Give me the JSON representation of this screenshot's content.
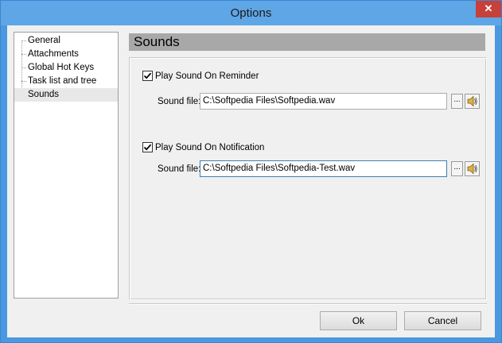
{
  "window": {
    "title": "Options",
    "close_glyph": "✕"
  },
  "tree": {
    "items": [
      {
        "label": "General"
      },
      {
        "label": "Attachments"
      },
      {
        "label": "Global Hot Keys"
      },
      {
        "label": "Task list and tree"
      },
      {
        "label": "Sounds",
        "selected": true
      }
    ]
  },
  "page": {
    "heading": "Sounds",
    "reminder": {
      "checkbox_label": "Play Sound On Reminder",
      "checked": true,
      "file_label": "Sound file:",
      "file_value": "C:\\Softpedia Files\\Softpedia.wav",
      "browse_label": "..."
    },
    "notification": {
      "checkbox_label": "Play Sound On Notification",
      "checked": true,
      "file_label": "Sound file:",
      "file_value": "C:\\Softpedia Files\\Softpedia-Test.wav",
      "browse_label": "..."
    }
  },
  "buttons": {
    "ok": "Ok",
    "cancel": "Cancel"
  },
  "icons": {
    "close": "close-icon",
    "check": "checkmark-icon",
    "speaker": "speaker-icon"
  },
  "colors": {
    "titlebar": "#5fa6e6",
    "close": "#c7403a",
    "heading": "#a8a8a8"
  }
}
